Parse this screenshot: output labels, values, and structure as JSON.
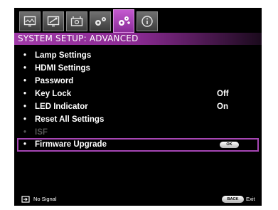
{
  "tabs": [
    {
      "icon": "picture-icon"
    },
    {
      "icon": "picture-advanced-icon"
    },
    {
      "icon": "audio-setup-icon"
    },
    {
      "icon": "system-setup-basic-icon"
    },
    {
      "icon": "system-setup-advanced-icon",
      "active": true
    },
    {
      "icon": "info-icon"
    }
  ],
  "menu": {
    "title": "SYSTEM SETUP: ADVANCED",
    "items": [
      {
        "label": "Lamp Settings",
        "value": ""
      },
      {
        "label": "HDMI Settings",
        "value": ""
      },
      {
        "label": "Password",
        "value": ""
      },
      {
        "label": "Key Lock",
        "value": "Off"
      },
      {
        "label": "LED Indicator",
        "value": "On"
      },
      {
        "label": "Reset All Settings",
        "value": ""
      },
      {
        "label": "ISF",
        "value": "",
        "disabled": true
      },
      {
        "label": "Firmware Upgrade",
        "value": "",
        "selected": true,
        "badge": "OK"
      }
    ],
    "bullet": "•"
  },
  "footer": {
    "source_label": "No Signal",
    "back_badge": "BACK",
    "exit_label": "Exit"
  },
  "colors": {
    "accent": "#a646b4",
    "background": "#000000",
    "disabled_text": "#555555"
  }
}
